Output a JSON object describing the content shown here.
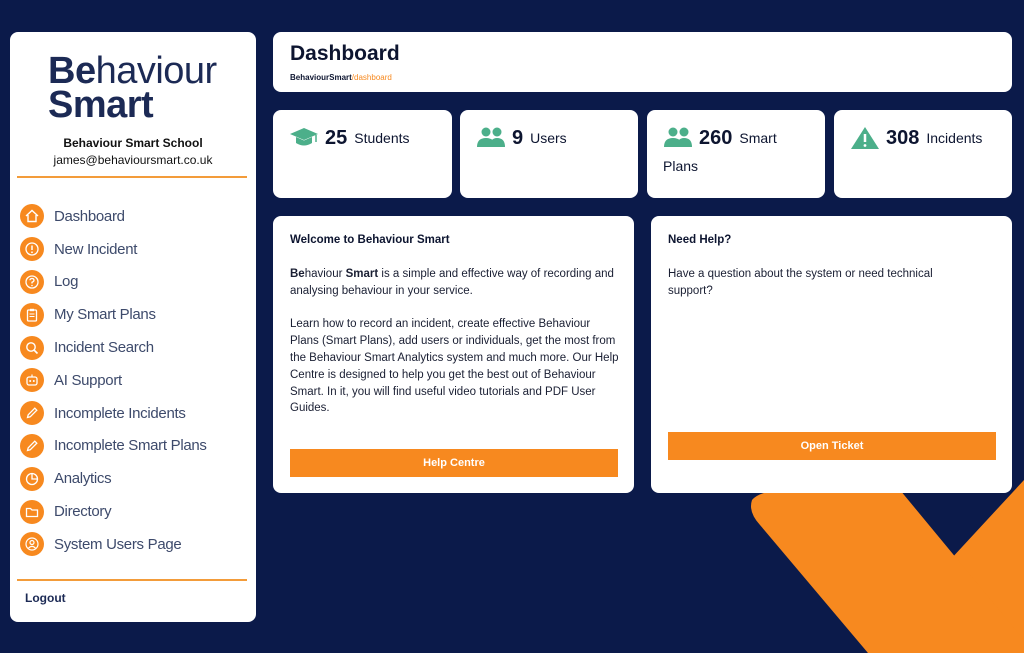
{
  "sidebar": {
    "logo": {
      "part1": "Be",
      "part2": "haviour",
      "line2": "Smart"
    },
    "school_name": "Behaviour Smart School",
    "email": "james@behavioursmart.co.uk",
    "nav_items": [
      {
        "label": "Dashboard",
        "icon": "home-icon"
      },
      {
        "label": "New Incident",
        "icon": "alert-circle-icon"
      },
      {
        "label": "Log",
        "icon": "question-icon"
      },
      {
        "label": "My Smart Plans",
        "icon": "clipboard-icon"
      },
      {
        "label": "Incident Search",
        "icon": "search-icon"
      },
      {
        "label": "AI Support",
        "icon": "robot-icon"
      },
      {
        "label": "Incomplete Incidents",
        "icon": "pencil-icon"
      },
      {
        "label": "Incomplete Smart Plans",
        "icon": "pencil-icon"
      },
      {
        "label": "Analytics",
        "icon": "pie-chart-icon"
      },
      {
        "label": "Directory",
        "icon": "folder-icon"
      },
      {
        "label": "System Users Page",
        "icon": "user-icon"
      }
    ],
    "logout_label": "Logout"
  },
  "header": {
    "title": "Dashboard",
    "breadcrumb": {
      "root": "BehaviourSmart",
      "separator": "/",
      "current": "dashboard"
    }
  },
  "stats": [
    {
      "value": "25",
      "label": "Students",
      "label2": "",
      "icon": "graduation-cap-icon"
    },
    {
      "value": "9",
      "label": "Users",
      "label2": "",
      "icon": "users-icon"
    },
    {
      "value": "260",
      "label": "Smart",
      "label2": "Plans",
      "icon": "users-icon"
    },
    {
      "value": "308",
      "label": "Incidents",
      "label2": "",
      "icon": "warning-icon"
    }
  ],
  "welcome": {
    "title": "Welcome to Behaviour Smart",
    "intro_b1": "Be",
    "intro_r1": "haviour ",
    "intro_b2": "Smart",
    "intro_rest": " is a simple and effective way of recording and analysing behaviour in your service.",
    "body": "Learn how to record an incident, create effective Behaviour Plans (Smart Plans), add users or individuals, get the most from the Behaviour Smart Analytics system and much more. Our Help Centre is designed to help you get the best out of Behaviour Smart. In it, you will find useful video tutorials and PDF User Guides.",
    "button_label": "Help Centre"
  },
  "help": {
    "title": "Need Help?",
    "body": "Have a question about the system or need technical support?",
    "button_label": "Open Ticket"
  },
  "colors": {
    "background": "#0b1a4a",
    "accent": "#f7891f",
    "stat_icon": "#4caf8a",
    "brand_text": "#1c2a55"
  }
}
